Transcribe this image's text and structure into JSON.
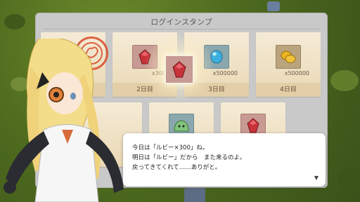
{
  "panel": {
    "title": "ログインスタンプ"
  },
  "cards": [
    {
      "day": "",
      "qty": "",
      "icon": "stamped-reward-icon",
      "color": ""
    },
    {
      "day": "2日目",
      "qty": "x300",
      "icon": "ruby-icon",
      "color": "#c7323a"
    },
    {
      "day": "3日目",
      "qty": "x500000",
      "icon": "blue-gem-icon",
      "color": "#3bb0e0"
    },
    {
      "day": "4日目",
      "qty": "x500000",
      "icon": "gold-nugget-icon",
      "color": "#e9b420"
    },
    {
      "day": "",
      "qty": "",
      "icon": "ruby-icon",
      "color": "#c7323a"
    },
    {
      "day": "",
      "qty": "",
      "icon": "slime-icon",
      "color": "#7fc37a"
    },
    {
      "day": "",
      "qty": "",
      "icon": "ruby-icon",
      "color": "#c7323a"
    }
  ],
  "dialog": {
    "line1": "今日は「ルビー×300」ね。",
    "line2": "明日は「ルビー」だから　また来るのよ。",
    "line3": "戻ってきてくれて……ありがと。",
    "next_indicator": "▼"
  },
  "colors": {
    "ruby": "#c7323a",
    "stamp": "#d94b2a",
    "grass": "#5a7a24"
  }
}
